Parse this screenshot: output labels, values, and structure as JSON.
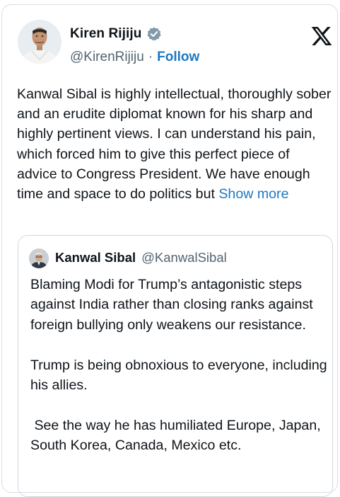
{
  "author": {
    "name": "Kiren Rijiju",
    "handle": "@KirenRijiju",
    "separator": "·",
    "follow_label": "Follow",
    "verified_color": "#829aab"
  },
  "logo_icon": "x-logo-icon",
  "tweet": {
    "text": "Kanwal Sibal is highly intellectual, thoroughly sober and an erudite diplomat known for his sharp and highly pertinent views. I can understand his pain, which forced him to give this perfect piece of advice to Congress President. We have enough time and space to do politics but",
    "show_more_label": " Show more"
  },
  "quoted": {
    "name": "Kanwal Sibal",
    "handle": "@KanwalSibal",
    "paragraphs": [
      "Blaming Modi for Trump’s antagonistic steps against India rather than closing ranks against foreign bullying only weakens our resistance.",
      "Trump is being obnoxious to everyone, including his allies.",
      " See the way he has humiliated Europe, Japan, South Korea, Canada, Mexico etc."
    ]
  },
  "colors": {
    "link": "#1d78c1",
    "text": "#0f1419",
    "secondary": "#536471"
  }
}
